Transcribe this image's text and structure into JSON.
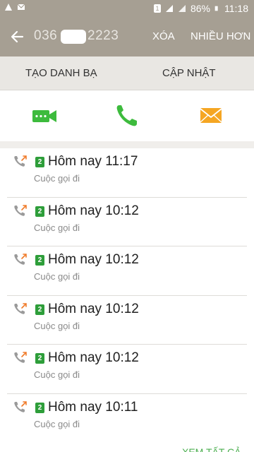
{
  "status_bar": {
    "battery": "86%",
    "time": "11:18",
    "sim_indicator": "1"
  },
  "app_bar": {
    "back_icon": "arrow-left-icon",
    "number_prefix": "036",
    "number_suffix": "2223",
    "delete_label": "XÓA",
    "more_label": "NHIỀU HƠN"
  },
  "tabs": {
    "create_contact": "TẠO DANH BẠ",
    "update": "CẬP NHẬT"
  },
  "actions": {
    "video_icon": "video-call-icon",
    "call_icon": "phone-call-icon",
    "message_icon": "envelope-icon",
    "colors": {
      "video": "#3dbb3d",
      "call": "#3dbb3d",
      "message": "#f5a623"
    }
  },
  "calls": [
    {
      "sim": "2",
      "time": "Hôm nay 11:17",
      "type": "Cuộc gọi đi"
    },
    {
      "sim": "2",
      "time": "Hôm nay 10:12",
      "type": "Cuộc gọi đi"
    },
    {
      "sim": "2",
      "time": "Hôm nay 10:12",
      "type": "Cuộc gọi đi"
    },
    {
      "sim": "2",
      "time": "Hôm nay 10:12",
      "type": "Cuộc gọi đi"
    },
    {
      "sim": "2",
      "time": "Hôm nay 10:12",
      "type": "Cuộc gọi đi"
    },
    {
      "sim": "2",
      "time": "Hôm nay 10:11",
      "type": "Cuộc gọi đi"
    }
  ],
  "see_all_label": "XEM TẤT CẢ"
}
